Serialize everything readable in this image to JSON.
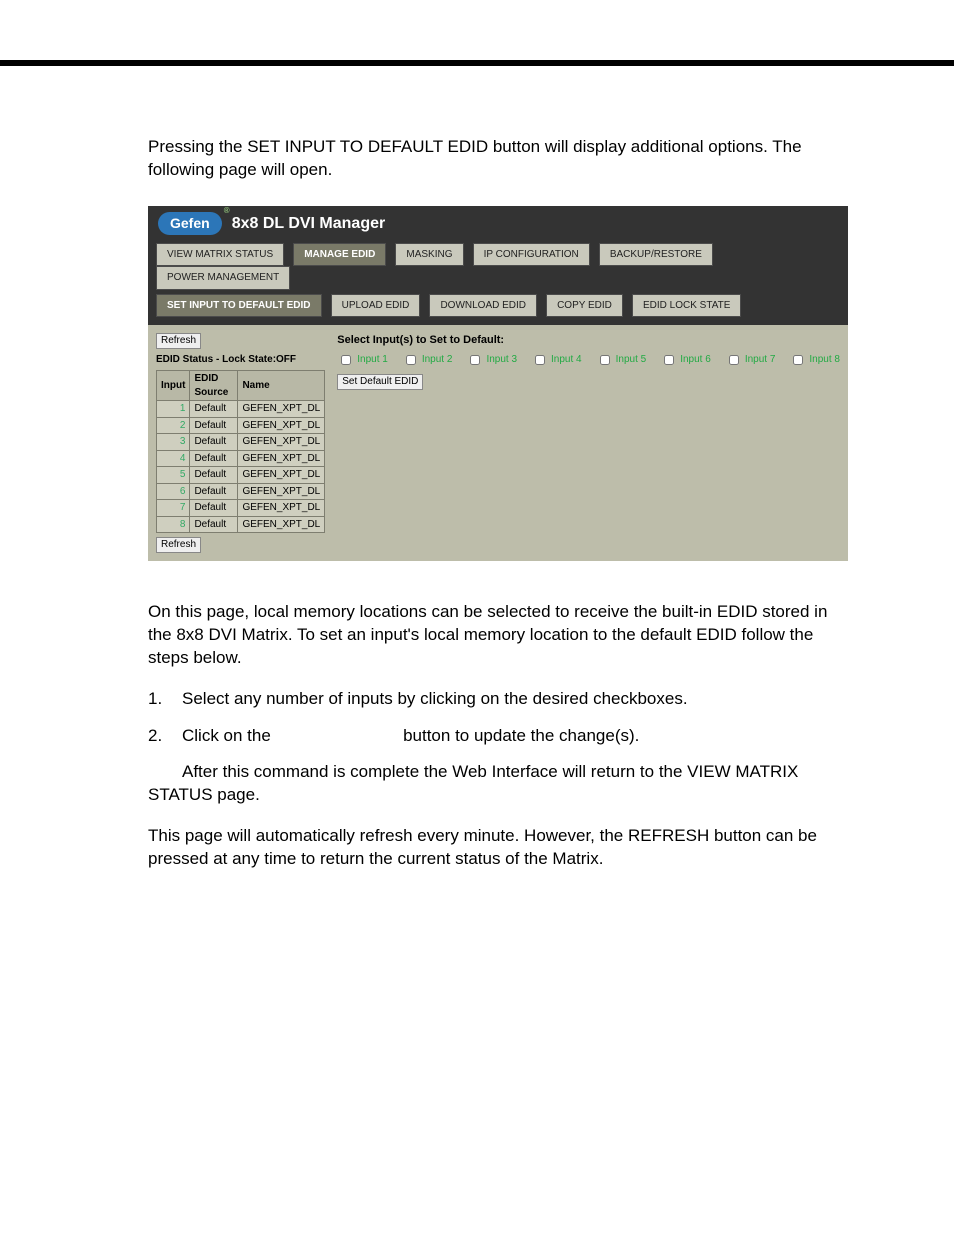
{
  "intro_text": "Pressing the SET INPUT TO DEFAULT EDID button will display additional options. The following page will open.",
  "app": {
    "logo": "Gefen",
    "title": "8x8 DL DVI Manager",
    "tabs": [
      "VIEW MATRIX STATUS",
      "MANAGE EDID",
      "MASKING",
      "IP CONFIGURATION",
      "BACKUP/RESTORE",
      "POWER MANAGEMENT"
    ],
    "active_tab_index": 1,
    "subtabs": [
      "SET INPUT TO DEFAULT EDID",
      "UPLOAD EDID",
      "DOWNLOAD EDID",
      "COPY EDID",
      "EDID LOCK STATE"
    ],
    "active_subtab_index": 0,
    "refresh_label": "Refresh",
    "status_line": "EDID Status - Lock State:OFF",
    "table": {
      "headers": [
        "Input",
        "EDID Source",
        "Name"
      ],
      "rows": [
        {
          "input": "1",
          "source": "Default",
          "name": "GEFEN_XPT_DL"
        },
        {
          "input": "2",
          "source": "Default",
          "name": "GEFEN_XPT_DL"
        },
        {
          "input": "3",
          "source": "Default",
          "name": "GEFEN_XPT_DL"
        },
        {
          "input": "4",
          "source": "Default",
          "name": "GEFEN_XPT_DL"
        },
        {
          "input": "5",
          "source": "Default",
          "name": "GEFEN_XPT_DL"
        },
        {
          "input": "6",
          "source": "Default",
          "name": "GEFEN_XPT_DL"
        },
        {
          "input": "7",
          "source": "Default",
          "name": "GEFEN_XPT_DL"
        },
        {
          "input": "8",
          "source": "Default",
          "name": "GEFEN_XPT_DL"
        }
      ]
    },
    "select_heading": "Select Input(s) to Set to Default:",
    "input_checkboxes": [
      "Input 1",
      "Input 2",
      "Input 3",
      "Input 4",
      "Input 5",
      "Input 6",
      "Input 7",
      "Input 8"
    ],
    "set_default_button": "Set Default EDID"
  },
  "para2": "On this page, local memory locations can be selected to receive the built-in EDID stored in the 8x8 DVI Matrix. To set an input's local memory location to the default EDID follow the steps below.",
  "step1_num": "1.",
  "step1_text": "Select any number of inputs by clicking on the desired checkboxes.",
  "step2_num": "2.",
  "step2_text_a": "Click on the",
  "step2_text_b": "button to update the change(s).",
  "para3": "After this command is complete the Web Interface will return to the VIEW MATRIX STATUS page.",
  "para4": "This page will automatically refresh every minute.  However, the  REFRESH button can be pressed at any time to return the current status of the Matrix."
}
